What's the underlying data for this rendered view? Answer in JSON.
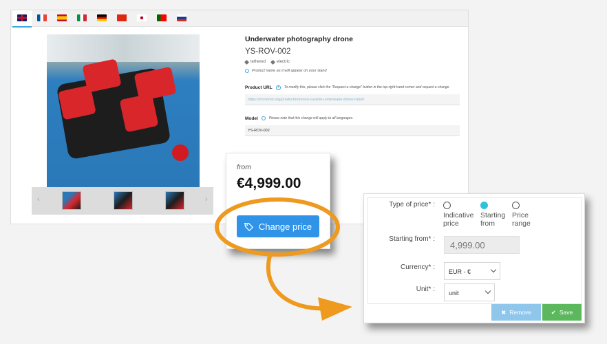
{
  "languages": [
    {
      "code": "en",
      "icon": "flag-uk-icon"
    },
    {
      "code": "fr",
      "icon": "flag-france-icon"
    },
    {
      "code": "es",
      "icon": "flag-spain-icon"
    },
    {
      "code": "it",
      "icon": "flag-italy-icon"
    },
    {
      "code": "de",
      "icon": "flag-germany-icon"
    },
    {
      "code": "zh",
      "icon": "flag-china-icon"
    },
    {
      "code": "ja",
      "icon": "flag-japan-icon"
    },
    {
      "code": "pt",
      "icon": "flag-portugal-icon"
    },
    {
      "code": "ru",
      "icon": "flag-russia-icon"
    }
  ],
  "product": {
    "name": "Underwater photography drone",
    "reference": "YS-ROV-002",
    "tags": [
      "tethered",
      "electric"
    ],
    "name_note": "Product name as it will appear on your stand",
    "url_label": "Product URL",
    "url_hint": "To modify this, please click the \"Request a change\" button in the top right-hand corner and request a change.",
    "url_value": "https://nnnmnnr.org/product/nnmnnn-custom-underwater-drone-robot/",
    "model_label": "Model",
    "model_hint": "Please note that this change will apply to all languages.",
    "model_value": "YS-ROV-002"
  },
  "gallery": {
    "prev": "‹",
    "next": "›",
    "thumbnail_count": 3
  },
  "price_card": {
    "from_label": "from",
    "price": "€4,999.00",
    "change_button": "Change price"
  },
  "price_form": {
    "type_label": "Type of price* :",
    "type_options": [
      {
        "line1": "Indicative",
        "line2": "price",
        "checked": false
      },
      {
        "line1": "Starting",
        "line2": "from",
        "checked": true
      },
      {
        "line1": "Price",
        "line2": "range",
        "checked": false
      }
    ],
    "starting_label": "Starting from* :",
    "starting_value": "4,999.00",
    "currency_label": "Currency* :",
    "currency_value": "EUR - €",
    "unit_label": "Unit* :",
    "unit_value": "unit",
    "remove_button": "Remove",
    "save_button": "Save"
  },
  "colors": {
    "accent_blue": "#2f93e8",
    "radio_checked": "#2fc2df",
    "save_green": "#5cb85c",
    "remove_blue": "#8fc6ec",
    "annotation_orange": "#ee9a1f"
  }
}
